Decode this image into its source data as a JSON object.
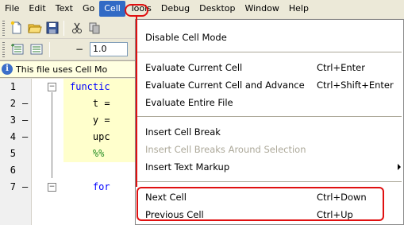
{
  "menubar": {
    "items": [
      "File",
      "Edit",
      "Text",
      "Go",
      "Cell",
      "Tools",
      "Debug",
      "Desktop",
      "Window",
      "Help"
    ],
    "active_index": 4
  },
  "toolbar2": {
    "minus_label": "−",
    "number_value": "1.0"
  },
  "infobar": {
    "text": "This file uses Cell Mo"
  },
  "editor": {
    "lines": [
      {
        "num": "1",
        "dash": "",
        "code": "functic"
      },
      {
        "num": "2",
        "dash": "–",
        "code": "    t ="
      },
      {
        "num": "3",
        "dash": "–",
        "code": "    y ="
      },
      {
        "num": "4",
        "dash": "–",
        "code": "    upc"
      },
      {
        "num": "5",
        "dash": "",
        "code": "    %%"
      },
      {
        "num": "6",
        "dash": "",
        "code": ""
      },
      {
        "num": "7",
        "dash": "–",
        "code": "    for"
      }
    ]
  },
  "cell_menu": {
    "items": [
      {
        "label": "Disable Cell Mode",
        "shortcut": "",
        "disabled": false
      },
      {
        "label": "Evaluate Current Cell",
        "shortcut": "Ctrl+Enter",
        "disabled": false
      },
      {
        "label": "Evaluate Current Cell and Advance",
        "shortcut": "Ctrl+Shift+Enter",
        "disabled": false
      },
      {
        "label": "Evaluate Entire File",
        "shortcut": "",
        "disabled": false
      },
      {
        "label": "Insert Cell Break",
        "shortcut": "",
        "disabled": false
      },
      {
        "label": "Insert Cell Breaks Around Selection",
        "shortcut": "",
        "disabled": true
      },
      {
        "label": "Insert Text Markup",
        "shortcut": "",
        "disabled": false
      },
      {
        "label": "Next Cell",
        "shortcut": "Ctrl+Down",
        "disabled": false
      },
      {
        "label": "Previous Cell",
        "shortcut": "Ctrl+Up",
        "disabled": false
      }
    ]
  },
  "colors": {
    "menu_highlight": "#316ac5",
    "annotation": "#e01010",
    "cell_background": "#ffffcc",
    "keyword": "#0000ff",
    "comment": "#228b22"
  },
  "icons": [
    "new-file-icon",
    "open-folder-icon",
    "save-icon",
    "cut-icon",
    "copy-icon",
    "cell-insert-icon",
    "cell-break-icon",
    "info-icon",
    "submenu-arrow-icon"
  ]
}
